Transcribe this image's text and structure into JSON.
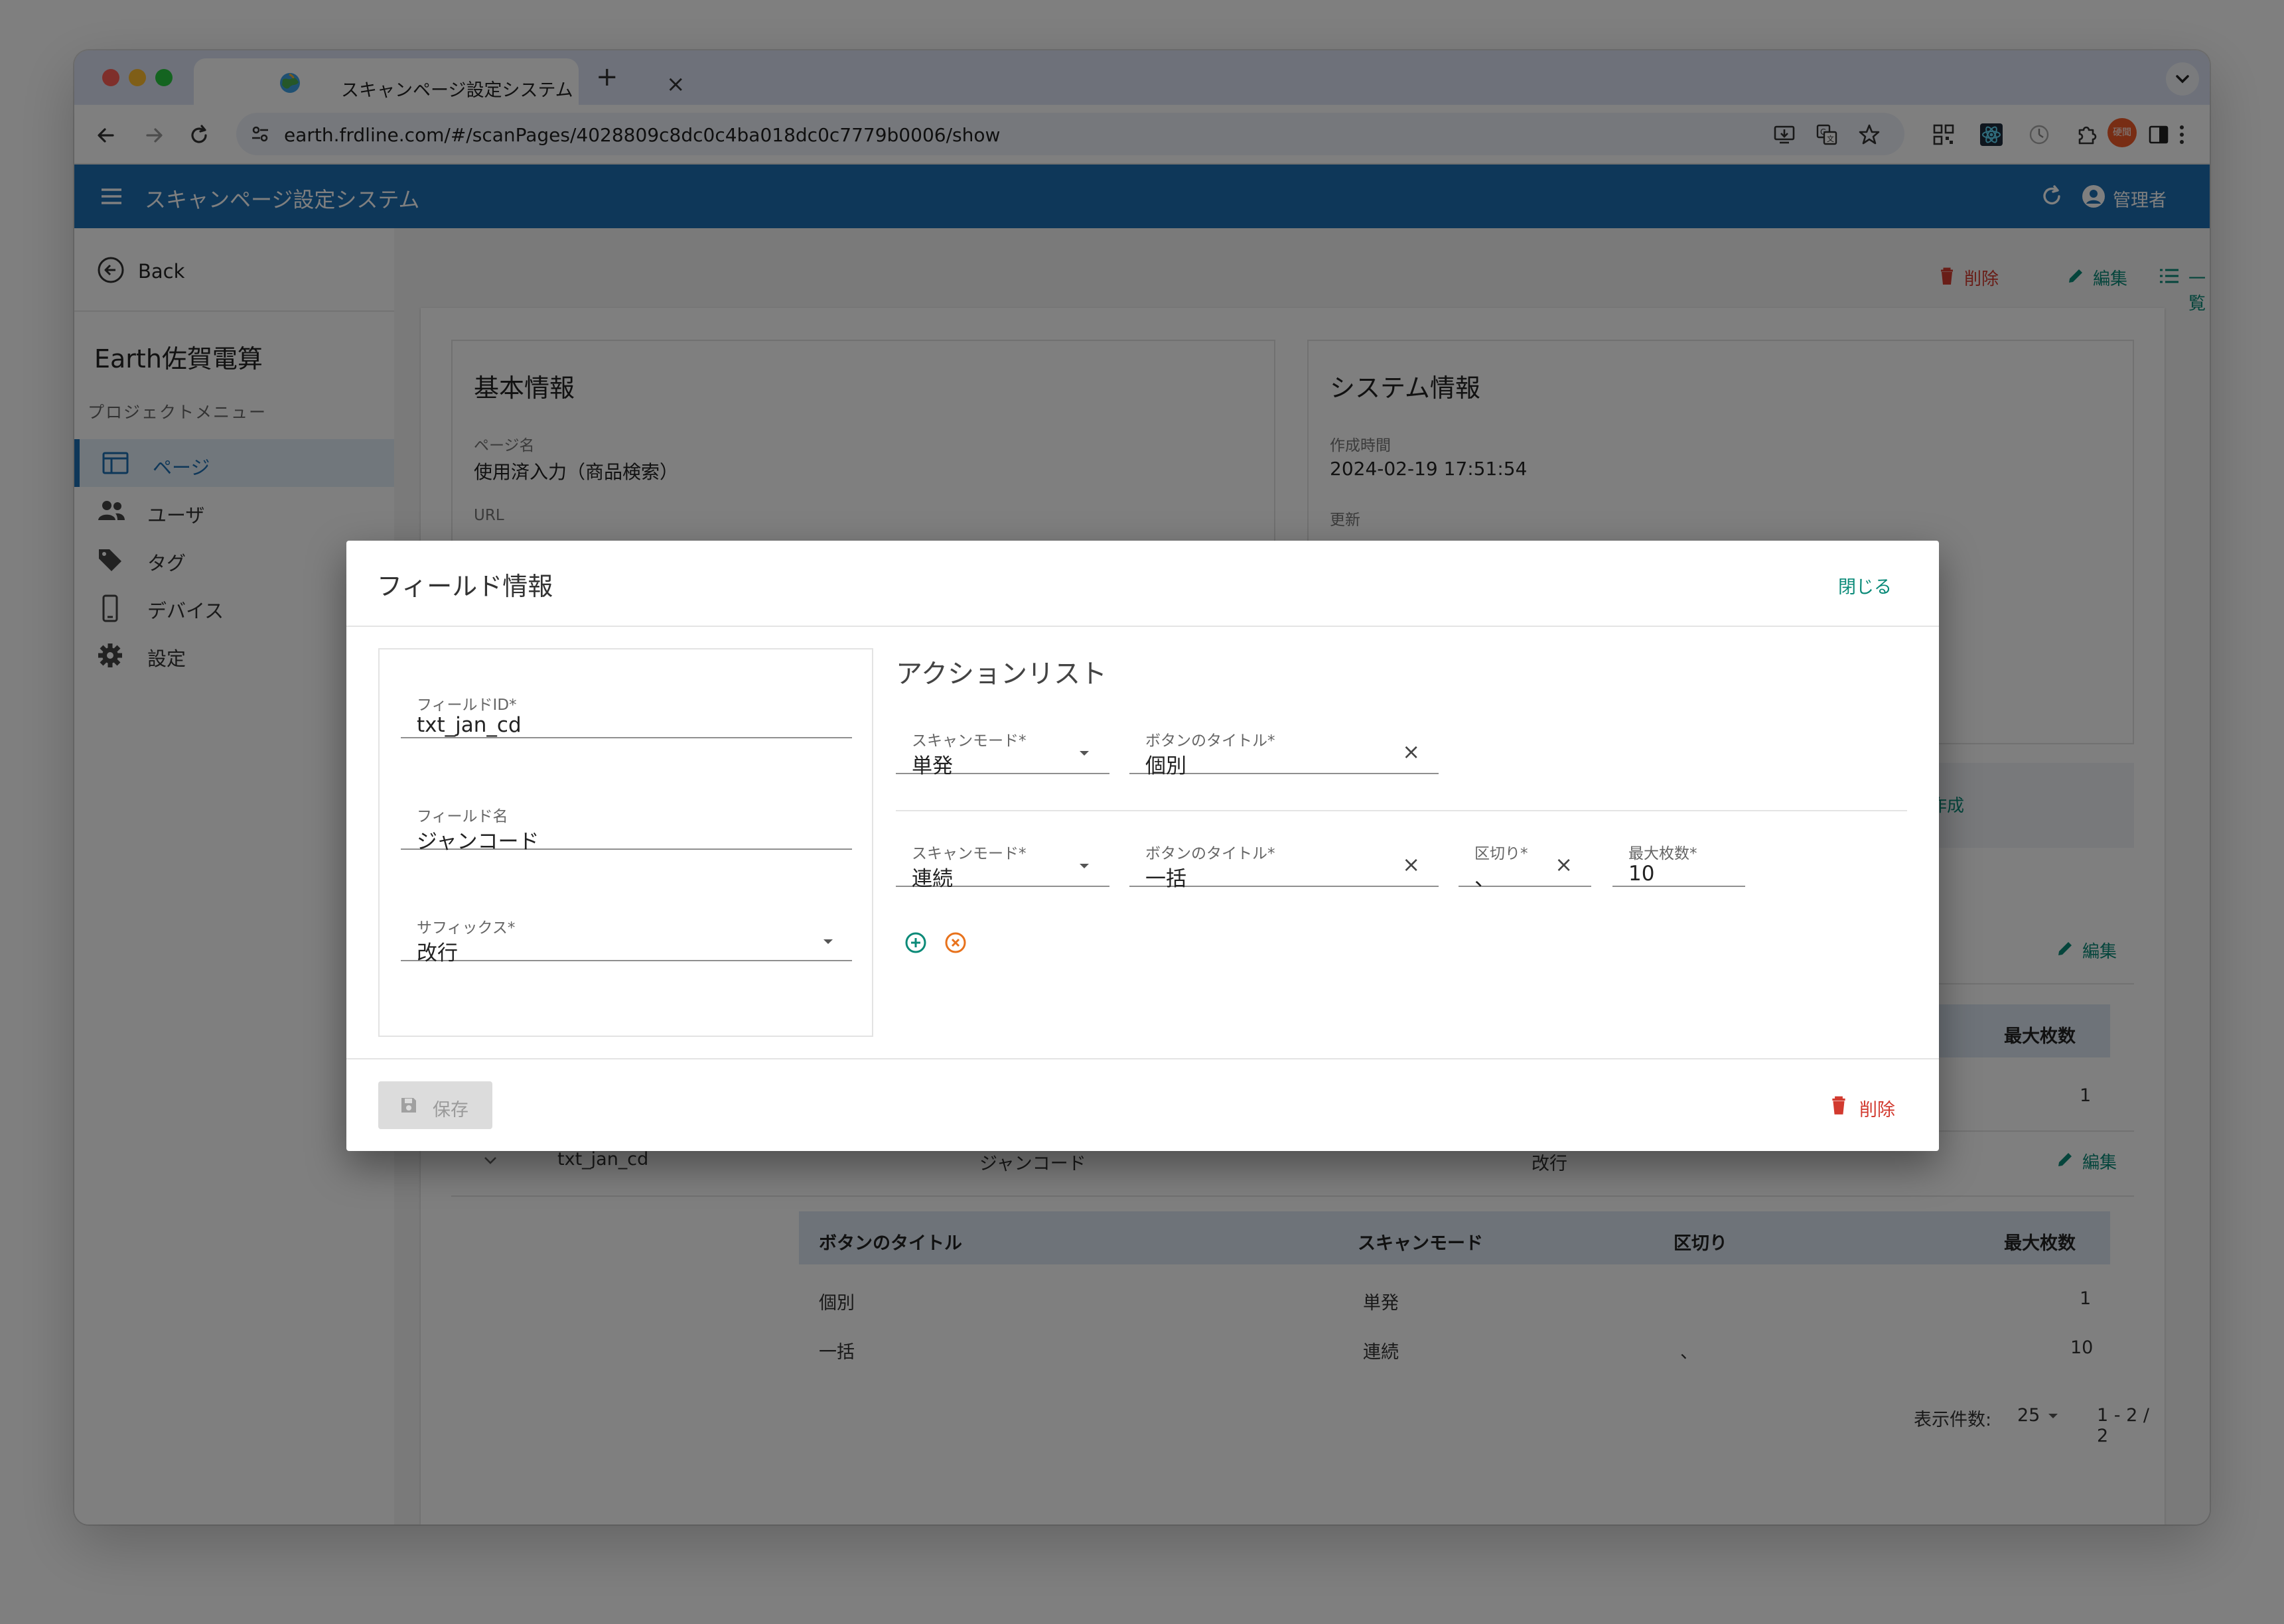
{
  "browser": {
    "tab_title": "スキャンページ設定システム",
    "url": "earth.frdline.com/#/scanPages/4028809c8dc0c4ba018dc0c7779b0006/show",
    "avatar_text": "硬聞"
  },
  "appbar": {
    "title": "スキャンページ設定システム",
    "user": "管理者"
  },
  "sidebar": {
    "back_label": "Back",
    "org_name": "Earth佐賀電算",
    "menu_header": "プロジェクトメニュー",
    "items": [
      {
        "label": "ページ",
        "icon": "page-icon",
        "active": true
      },
      {
        "label": "ユーザ",
        "icon": "users-icon",
        "active": false
      },
      {
        "label": "タグ",
        "icon": "tag-icon",
        "active": false
      },
      {
        "label": "デバイス",
        "icon": "device-icon",
        "active": false
      },
      {
        "label": "設定",
        "icon": "settings-icon",
        "active": false
      }
    ]
  },
  "page_actions": {
    "delete": "削除",
    "edit": "編集",
    "list": "一覧"
  },
  "basic_info": {
    "title": "基本情報",
    "page_name_label": "ページ名",
    "page_name": "使用済入力（商品検索）",
    "url_label": "URL"
  },
  "system_info": {
    "title": "システム情報",
    "created_label": "作成時間",
    "created": "2024-02-19 17:51:54",
    "updated_label": "更新"
  },
  "fields_section": {
    "create_label": "作成",
    "edit_label": "編集",
    "first_table": {
      "visible_header": "最大枚数",
      "visible_value": "1"
    },
    "row": {
      "field_id": "txt_jan_cd",
      "field_name": "ジャンコード",
      "suffix": "改行",
      "edit_label": "編集"
    },
    "table": {
      "headers": [
        "ボタンのタイトル",
        "スキャンモード",
        "区切り",
        "最大枚数"
      ],
      "rows": [
        {
          "title": "個別",
          "mode": "単発",
          "sep": "",
          "max": "1"
        },
        {
          "title": "一括",
          "mode": "連続",
          "sep": "、",
          "max": "10"
        }
      ]
    },
    "pagination": {
      "per_page_label": "表示件数:",
      "per_page": "25",
      "range": "1 - 2 / 2"
    }
  },
  "dialog": {
    "title": "フィールド情報",
    "close_label": "閉じる",
    "field_id_label": "フィールドID*",
    "field_id": "txt_jan_cd",
    "field_name_label": "フィールド名",
    "field_name": "ジャンコード",
    "suffix_label": "サフィックス*",
    "suffix": "改行",
    "action_list_title": "アクションリスト",
    "actions": [
      {
        "mode_label": "スキャンモード*",
        "mode": "単発",
        "title_label": "ボタンのタイトル*",
        "title": "個別"
      },
      {
        "mode_label": "スキャンモード*",
        "mode": "連続",
        "title_label": "ボタンのタイトル*",
        "title": "一括",
        "sep_label": "区切り*",
        "sep": "、",
        "max_label": "最大枚数*",
        "max": "10"
      }
    ],
    "save_label": "保存",
    "delete_label": "削除"
  },
  "colors": {
    "appbar": "#1c6fb3",
    "accent": "#0a8a78",
    "danger": "#d23a2f",
    "remove": "#e8721c"
  }
}
